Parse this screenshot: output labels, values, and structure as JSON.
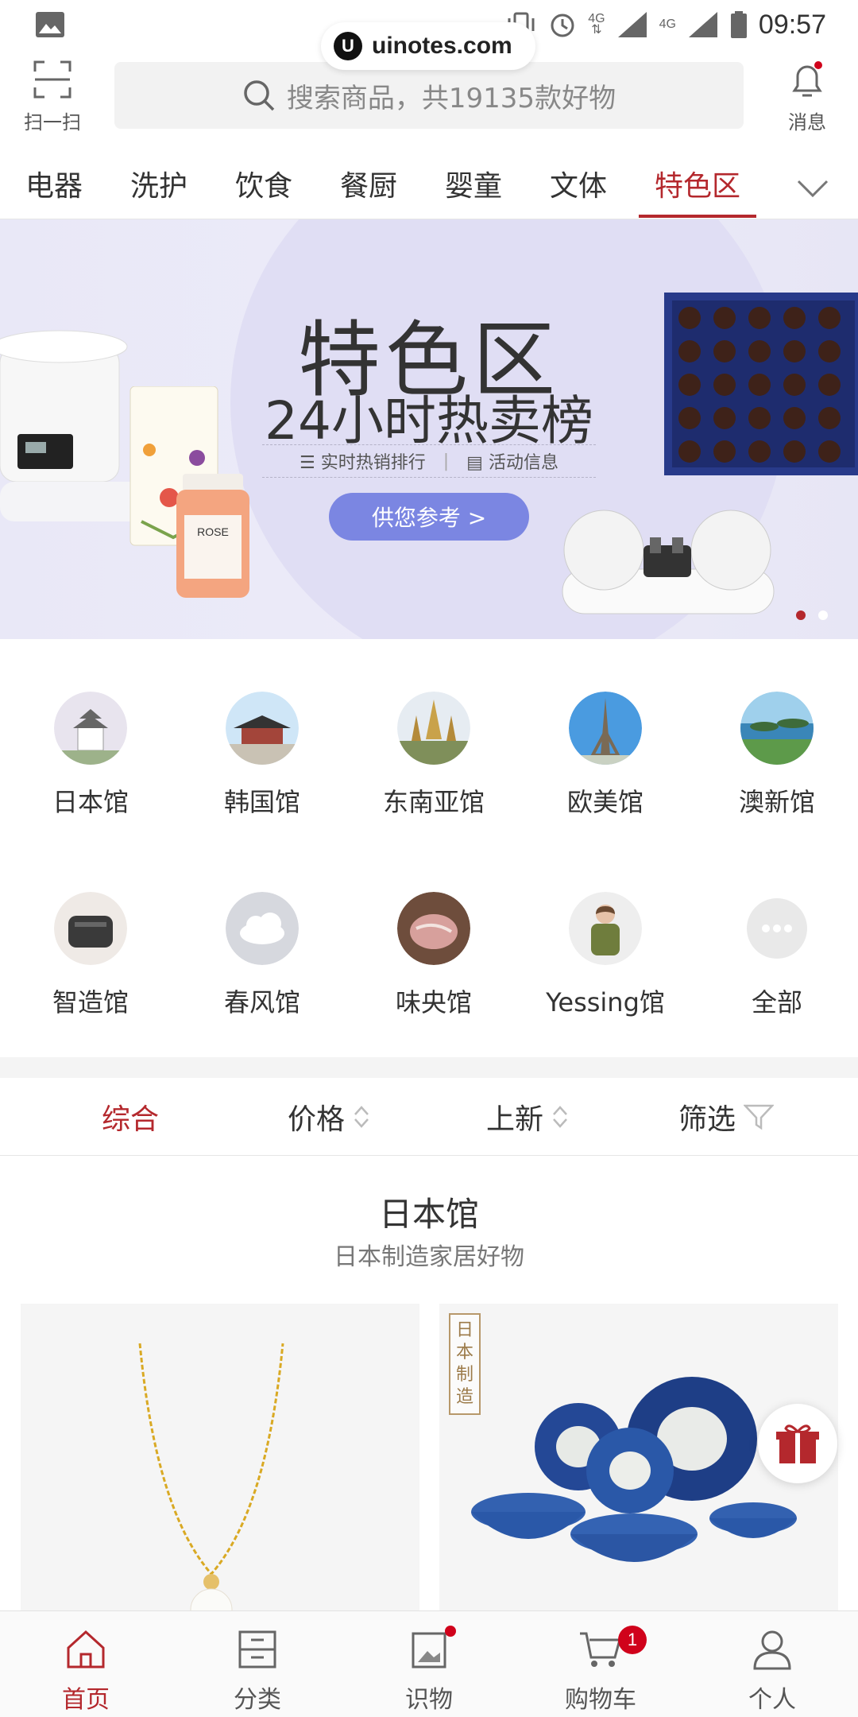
{
  "status_bar": {
    "time": "09:57",
    "network_1": "4G",
    "network_2": "4G"
  },
  "watermark": {
    "logo": "U",
    "text": "uinotes.com"
  },
  "header": {
    "scan_label": "扫一扫",
    "search_placeholder": "搜索商品，共19135款好物",
    "message_label": "消息"
  },
  "tabs": [
    {
      "label": "电器"
    },
    {
      "label": "洗护"
    },
    {
      "label": "饮食"
    },
    {
      "label": "餐厨"
    },
    {
      "label": "婴童"
    },
    {
      "label": "文体"
    },
    {
      "label": "特色区",
      "active": true
    }
  ],
  "banner": {
    "title": "特色区",
    "subtitle": "24小时热卖榜",
    "info_1": "实时热销排行",
    "info_2": "活动信息",
    "button": "供您参考 >",
    "dots": 2,
    "active_dot": 0
  },
  "pavilions": [
    {
      "label": "日本馆",
      "icon": "japan-castle-icon"
    },
    {
      "label": "韩国馆",
      "icon": "korea-palace-icon"
    },
    {
      "label": "东南亚馆",
      "icon": "thai-temple-icon"
    },
    {
      "label": "欧美馆",
      "icon": "eiffel-tower-icon"
    },
    {
      "label": "澳新馆",
      "icon": "nz-landscape-icon"
    },
    {
      "label": "智造馆",
      "icon": "smart-device-icon"
    },
    {
      "label": "春风馆",
      "icon": "cloud-icon"
    },
    {
      "label": "味央馆",
      "icon": "pork-meat-icon"
    },
    {
      "label": "Yessing馆",
      "icon": "fashion-model-icon"
    },
    {
      "label": "全部",
      "icon": "more-dots-icon"
    }
  ],
  "sort": {
    "comprehensive": "综合",
    "price": "价格",
    "newest": "上新",
    "filter": "筛选"
  },
  "section": {
    "title": "日本馆",
    "subtitle": "日本制造家居好物",
    "badge": "日本制造"
  },
  "bottom_nav": [
    {
      "label": "首页",
      "icon": "home-icon",
      "active": true
    },
    {
      "label": "分类",
      "icon": "category-icon"
    },
    {
      "label": "识物",
      "icon": "discover-icon"
    },
    {
      "label": "购物车",
      "icon": "cart-icon",
      "badge": "1"
    },
    {
      "label": "个人",
      "icon": "profile-icon"
    }
  ],
  "colors": {
    "accent": "#b4282d",
    "banner_button": "#7b86e2"
  }
}
